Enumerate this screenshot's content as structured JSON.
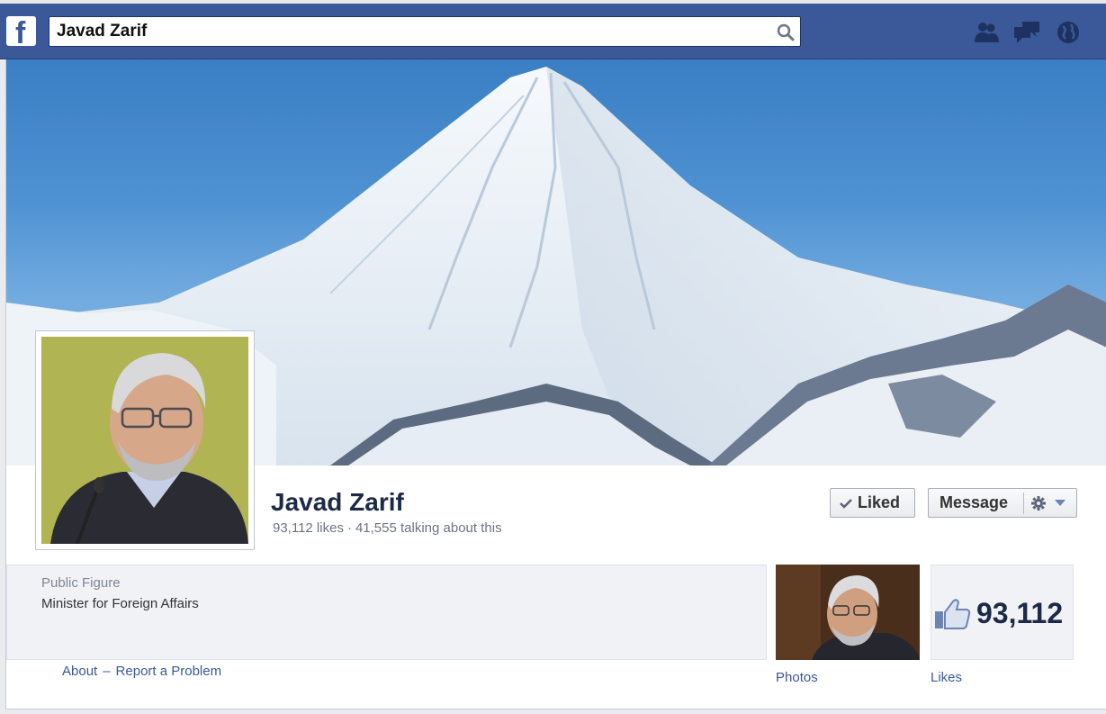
{
  "search": {
    "value": "Javad Zarif"
  },
  "page": {
    "name": "Javad Zarif",
    "likes_text": "93,112 likes",
    "talking_text": "41,555 talking about this",
    "separator": "·"
  },
  "actions": {
    "liked_label": "Liked",
    "message_label": "Message"
  },
  "about": {
    "category": "Public Figure",
    "description": "Minister for Foreign Affairs"
  },
  "footer": {
    "about_link": "About",
    "separator": "–",
    "report_link": "Report a Problem"
  },
  "tiles": {
    "photos_label": "Photos",
    "likes_label": "Likes",
    "likes_count": "93,112"
  },
  "colors": {
    "brand": "#3b5998",
    "name": "#1c2a47"
  },
  "icons": {
    "logo": "facebook-logo",
    "search": "search-icon",
    "friends": "friend-requests-icon",
    "messages": "messages-icon",
    "notifications": "globe-notifications-icon"
  }
}
